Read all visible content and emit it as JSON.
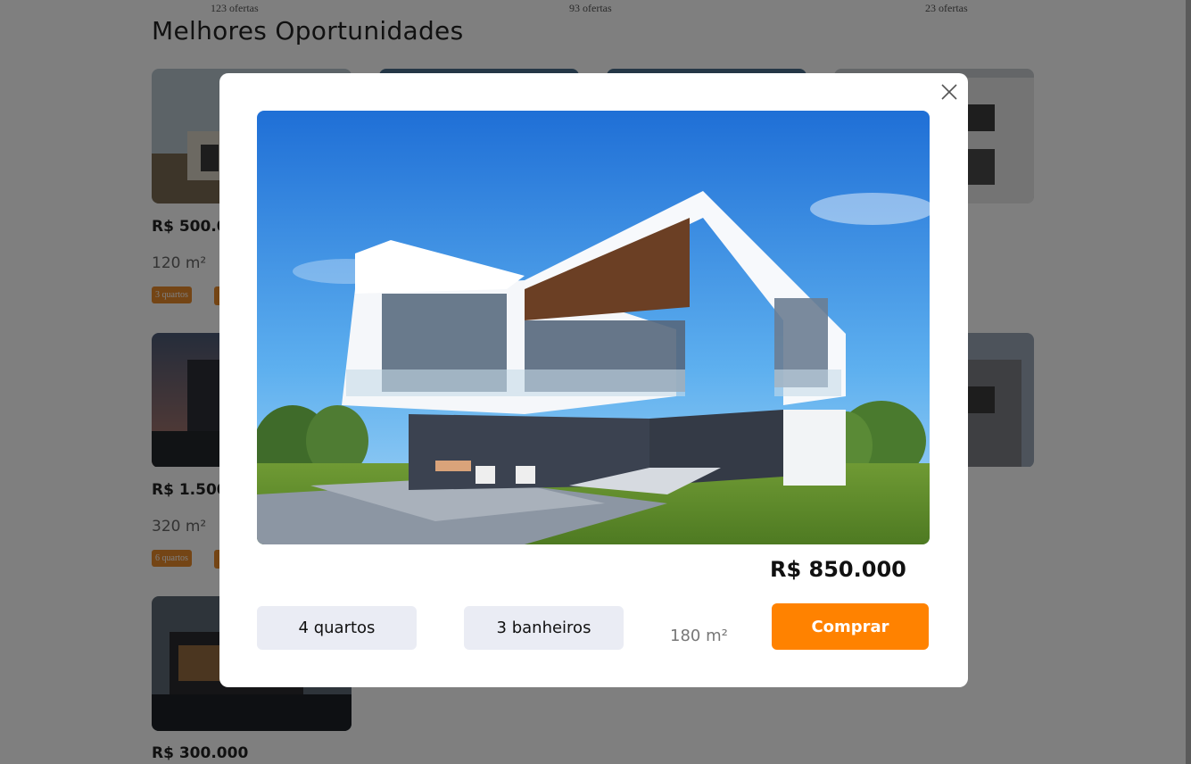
{
  "background": {
    "offer_counts": [
      "123 ofertas",
      "93 ofertas",
      "23 ofertas"
    ],
    "section_title": "Melhores Oportunidades",
    "cards": [
      {
        "price": "R$ 500.0",
        "area": "120 m²",
        "tag": "3 quartos"
      },
      {
        "price": "R$ 1.500",
        "area": "320 m²",
        "tag": "6 quartos"
      },
      {
        "price": "R$ 300.000"
      }
    ]
  },
  "modal": {
    "price": "R$ 850.000",
    "bedrooms": "4 quartos",
    "bathrooms": "3 banheiros",
    "area": "180 m²",
    "buy_label": "Comprar",
    "close_icon": "close-icon",
    "image_icon": "modern-house-photo"
  },
  "colors": {
    "accent": "#ff8200",
    "tag": "#e98a2b",
    "chip": "#eaecf4",
    "overlay": "rgba(0,0,0,0.5)"
  }
}
